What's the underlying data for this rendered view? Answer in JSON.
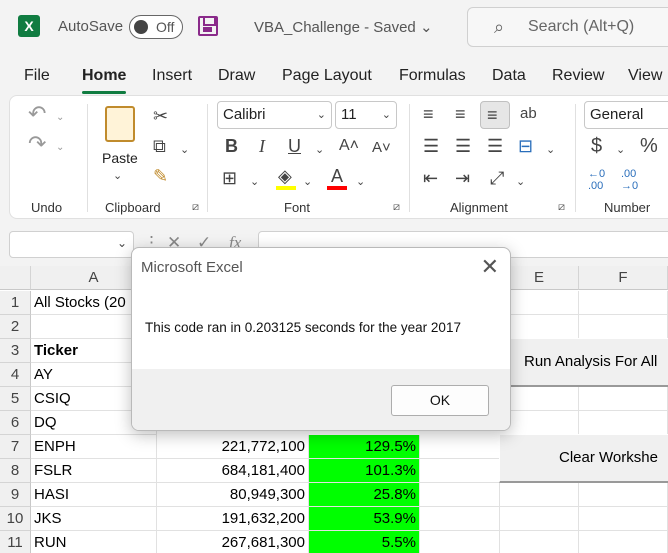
{
  "titlebar": {
    "app_icon": "excel-logo",
    "logo_letter": "X",
    "autosave_label": "AutoSave",
    "autosave_state": "Off",
    "document_title": "VBA_Challenge  -  Saved  ⌄",
    "search_placeholder": "Search (Alt+Q)"
  },
  "tabs": [
    "File",
    "Home",
    "Insert",
    "Draw",
    "Page Layout",
    "Formulas",
    "Data",
    "Review",
    "View"
  ],
  "active_tab": "Home",
  "ribbon": {
    "undo": {
      "label": "Undo"
    },
    "clipboard": {
      "label": "Clipboard",
      "paste_label": "Paste"
    },
    "font": {
      "label": "Font",
      "font_name": "Calibri",
      "font_size": "11",
      "bold": "B",
      "italic": "I",
      "underline": "U",
      "grow": "A˄",
      "shrink": "A˅",
      "font_color_glyph": "A"
    },
    "alignment": {
      "label": "Alignment"
    },
    "number": {
      "label": "Number",
      "format": "General",
      "currency": "$",
      "percent": "%"
    },
    "colors": {
      "accent": "#107c41",
      "highlight": "#ffff00",
      "font_color": "#ff0000"
    }
  },
  "formula_bar": {
    "fx": "fx"
  },
  "columns": [
    "A",
    "E",
    "F"
  ],
  "rows": [
    {
      "num": "1",
      "a": "All Stocks (20"
    },
    {
      "num": "2",
      "a": ""
    },
    {
      "num": "3",
      "a": "Ticker"
    },
    {
      "num": "4",
      "a": "AY"
    },
    {
      "num": "5",
      "a": "CSIQ"
    },
    {
      "num": "6",
      "a": "DQ"
    },
    {
      "num": "7",
      "a": "ENPH",
      "b": "221,772,100",
      "c": "129.5%"
    },
    {
      "num": "8",
      "a": "FSLR",
      "b": "684,181,400",
      "c": "101.3%"
    },
    {
      "num": "9",
      "a": "HASI",
      "b": "80,949,300",
      "c": "25.8%"
    },
    {
      "num": "10",
      "a": "JKS",
      "b": "191,632,200",
      "c": "53.9%"
    },
    {
      "num": "11",
      "a": "RUN",
      "b": "267,681,300",
      "c": "5.5%"
    }
  ],
  "buttons": {
    "run_analysis": "Run Analysis For All",
    "clear_worksheet": "Clear Workshe"
  },
  "dialog": {
    "title": "Microsoft Excel",
    "message": "This code ran in 0.203125 seconds for the year 2017",
    "ok_label": "OK"
  }
}
